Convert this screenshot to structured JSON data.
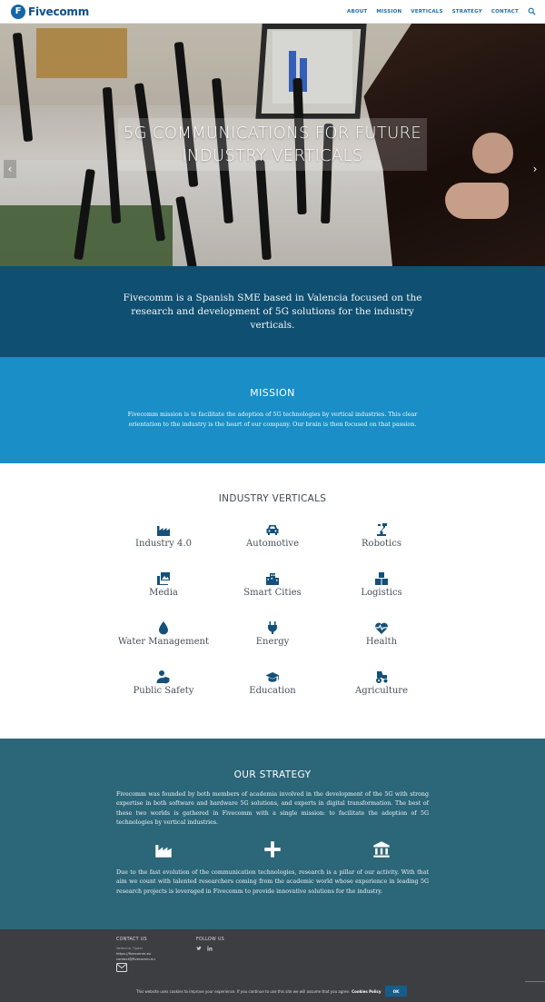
{
  "header": {
    "logo_mark": "F",
    "logo_text": "Fivecomm",
    "nav": [
      "ABOUT",
      "MISSION",
      "VERTICALS",
      "STRATEGY",
      "CONTACT"
    ]
  },
  "hero": {
    "title_line1": "5G COMMUNICATIONS FOR FUTURE",
    "title_line2": "INDUSTRY VERTICALS",
    "prev_arrow": "‹",
    "next_arrow": "›"
  },
  "intro": {
    "text": "Fivecomm is a Spanish SME based in Valencia focused on the research and development of 5G solutions for the industry verticals."
  },
  "mission": {
    "title": "MISSION",
    "text": "Fivecomm mission is to facilitate the adoption of 5G technologies by vertical industries. This clear orientation to the industry is the heart of our company. Our brain is then focused on that passion."
  },
  "verticals": {
    "title": "INDUSTRY VERTICALS",
    "items": [
      {
        "label": "Industry 4.0",
        "icon": "factory-icon"
      },
      {
        "label": "Automotive",
        "icon": "car-icon"
      },
      {
        "label": "Robotics",
        "icon": "robot-arm-icon"
      },
      {
        "label": "Media",
        "icon": "media-icon"
      },
      {
        "label": "Smart Cities",
        "icon": "city-icon"
      },
      {
        "label": "Logistics",
        "icon": "boxes-icon"
      },
      {
        "label": "Water Management",
        "icon": "water-drop-icon"
      },
      {
        "label": "Energy",
        "icon": "plug-icon"
      },
      {
        "label": "Health",
        "icon": "heartbeat-icon"
      },
      {
        "label": "Public Safety",
        "icon": "user-shield-icon"
      },
      {
        "label": "Education",
        "icon": "graduation-cap-icon"
      },
      {
        "label": "Agriculture",
        "icon": "tractor-icon"
      }
    ]
  },
  "strategy": {
    "title": "OUR STRATEGY",
    "paragraph1": "Fivecomm was founded by both members of academia involved in the development of the 5G with strong expertise in both software and hardware 5G solutions, and experts in digital transformation. The best of these two worlds is gathered in Fivecomm with a single mission: to facilitate the adoption of 5G technologies by vertical industries.",
    "paragraph2": "Due to the fast evolution of the communication technologies, research is a pillar of our activity. With that aim we count with talented researchers coming from the academic world whose experience in leading 5G research projects is leveraged in Fivecomm to provide innovative solutions for the industry."
  },
  "footer": {
    "contact_title": "CONTACT US",
    "contact_lines": [
      "Valencia, Spain",
      "https://fivecomm.eu",
      "contact@fivecomm.eu"
    ],
    "follow_title": "FOLLOW US"
  },
  "cookie": {
    "text": "This website uses cookies to improve your experience. If you continue to use this site we will assume that you agree.",
    "policy_label": "Cookies Policy",
    "ok_label": "OK"
  },
  "colors": {
    "intro_bg": "#0f4f71",
    "mission_bg": "#1a8ec7",
    "strategy_bg": "#2c6679",
    "footer_bg": "#3c3e42",
    "icon_color": "#13507a"
  }
}
